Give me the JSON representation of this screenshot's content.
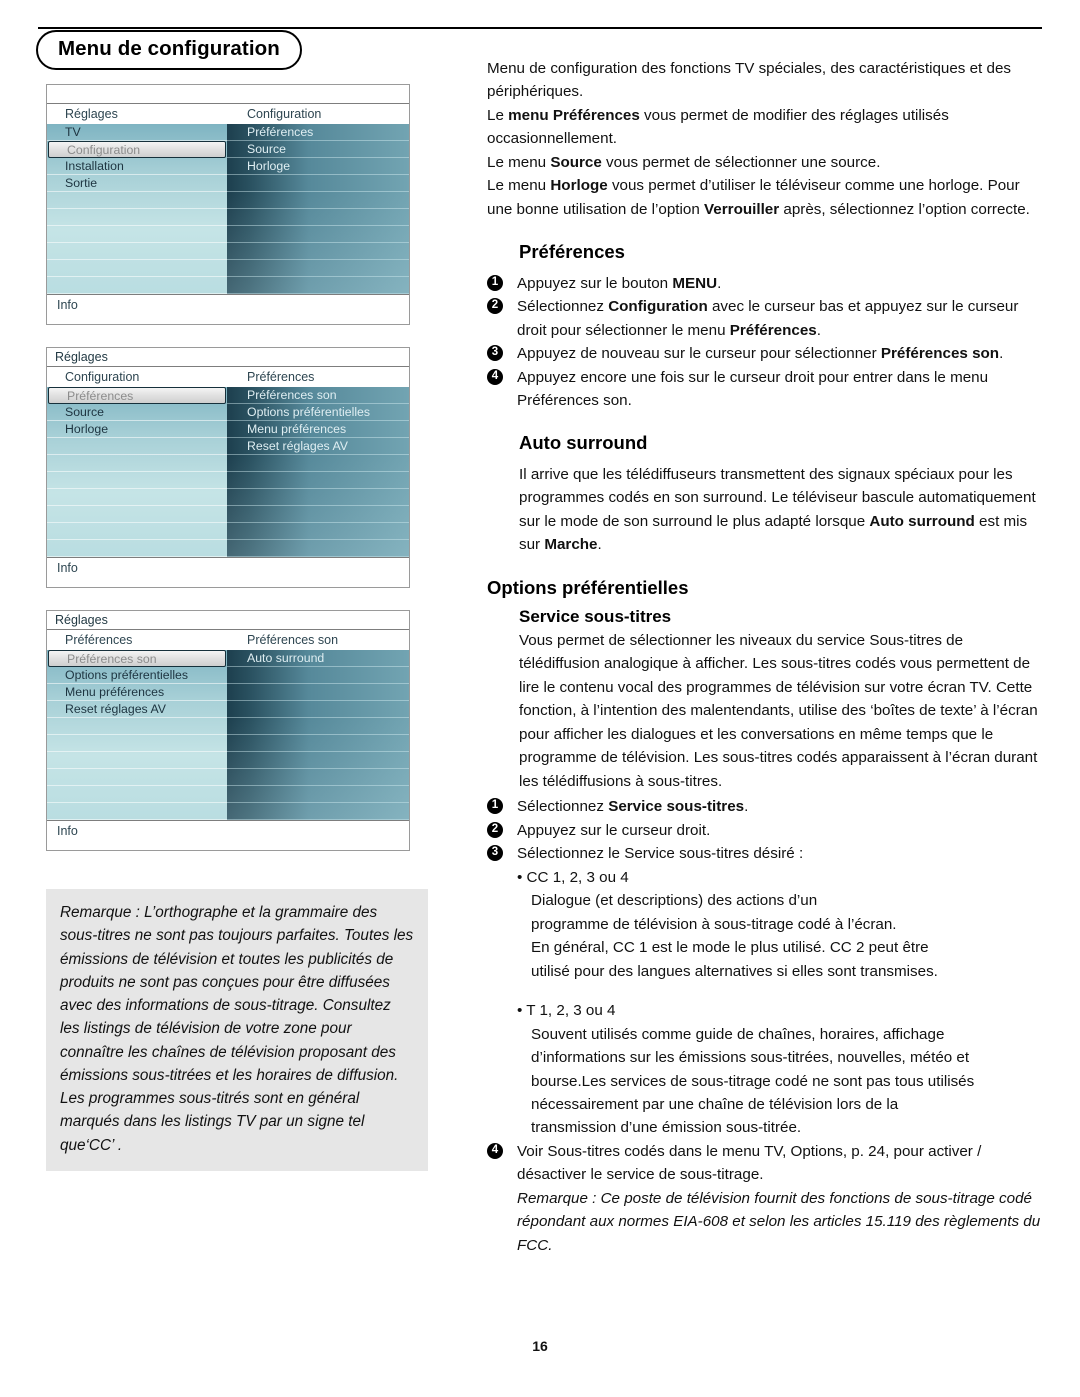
{
  "document": {
    "title": "Menu de configuration",
    "page_number": "16"
  },
  "menus": [
    {
      "name": "menu-configuration",
      "titlebar": "",
      "col_head_left": "Réglages",
      "col_head_right": "Configuration",
      "left_items": [
        {
          "label": "TV",
          "selected": false
        },
        {
          "label": "Configuration",
          "selected": true
        },
        {
          "label": "Installation",
          "selected": false
        },
        {
          "label": "Sortie",
          "selected": false
        }
      ],
      "right_items": [
        "Préférences",
        "Source",
        "Horloge"
      ],
      "info_label": "Info"
    },
    {
      "name": "menu-preferences",
      "titlebar": "Réglages",
      "col_head_left": "Configuration",
      "col_head_right": "Préférences",
      "left_items": [
        {
          "label": "Préférences",
          "selected": true
        },
        {
          "label": "Source",
          "selected": false
        },
        {
          "label": "Horloge",
          "selected": false
        }
      ],
      "right_items": [
        "Préférences son",
        "Options préférentielles",
        "Menu préférences",
        "Reset réglages AV"
      ],
      "info_label": "Info"
    },
    {
      "name": "menu-preferences-son",
      "titlebar": "Réglages",
      "col_head_left": "Préférences",
      "col_head_right": "Préférences son",
      "left_items": [
        {
          "label": "Préférences son",
          "selected": true
        },
        {
          "label": "Options préférentielles",
          "selected": false
        },
        {
          "label": "Menu préférences",
          "selected": false
        },
        {
          "label": "Reset réglages AV",
          "selected": false
        }
      ],
      "right_items": [
        "Auto surround"
      ],
      "info_label": "Info"
    }
  ],
  "remark_box": {
    "text": "Remarque : L’orthographe et la grammaire des sous-titres ne sont pas toujours parfaites. Toutes les émissions de télévision et toutes les publicités de produits ne sont pas conçues pour être diffusées avec des informations de sous-titrage. Consultez les listings de télévision de votre zone pour connaître les chaînes de télévision proposant des émissions sous-titrées et les horaires de diffusion. Les programmes sous-titrés sont en général marqués dans les listings TV par un signe tel que‘CC’ ."
  },
  "intro": {
    "line1": "Menu de configuration des fonctions TV spéciales, des caractéristiques et des périphériques.",
    "line2_pre": "Le ",
    "line2_bold": "menu Préférences",
    "line2_post": " vous permet de modifier des réglages utilisés occasionnellement.",
    "line3_pre": "Le menu ",
    "line3_bold": "Source",
    "line3_post": " vous permet de sélectionner une source.",
    "line4_pre": "Le menu ",
    "line4_bold": "Horloge",
    "line4_mid": " vous permet d’utiliser le téléviseur comme une horloge. Pour une bonne utilisation de l’option ",
    "line4_bold2": "Verrouiller",
    "line4_post": " après, sélectionnez l’option correcte."
  },
  "preferences": {
    "heading": "Préférences",
    "steps": [
      {
        "num": "1",
        "pre": "Appuyez sur le bouton ",
        "bold": "MENU",
        "post": "."
      },
      {
        "num": "2",
        "pre": "Sélectionnez ",
        "bold": "Configuration",
        "mid": " avec le curseur bas et appuyez sur le curseur droit pour sélectionner le menu ",
        "bold2": "Préférences",
        "post": "."
      },
      {
        "num": "3",
        "pre": "Appuyez de nouveau sur le curseur pour sélectionner ",
        "bold": "Préférences son",
        "post": "."
      },
      {
        "num": "4",
        "pre": "Appuyez encore une fois sur le curseur droit pour entrer dans le menu Préférences son.",
        "bold": "",
        "post": ""
      }
    ]
  },
  "auto_surround": {
    "heading": "Auto surround",
    "body_pre": "Il arrive que les télédiffuseurs transmettent des signaux spéciaux pour les programmes codés en son surround. Le téléviseur bascule automatiquement sur le mode de son surround le plus adapté lorsque ",
    "body_bold": "Auto surround",
    "body_mid": " est mis sur ",
    "body_bold2": "Marche",
    "body_post": "."
  },
  "options_preferentielles": {
    "heading": "Options préférentielles",
    "subheading": "Service sous-titres",
    "body": "Vous permet de sélectionner les niveaux du service Sous-titres de télédiffusion analogique à afficher. Les sous-titres codés vous permettent de lire le contenu vocal des programmes de télévision sur votre écran TV. Cette fonction, à l’intention des malentendants, utilise des ‘boîtes de texte’ à l’écran pour afficher les dialogues et les conversations en même temps que le programme de télévision. Les sous-titres codés apparaissent à l’écran durant les télédiffusions à sous-titres.",
    "steps": [
      {
        "num": "1",
        "pre": "Sélectionnez ",
        "bold": "Service sous-titres",
        "post": "."
      },
      {
        "num": "2",
        "pre": "Appuyez sur le curseur droit.",
        "bold": "",
        "post": ""
      },
      {
        "num": "3",
        "pre": "Sélectionnez le Service sous-titres désiré :",
        "bold": "",
        "post": ""
      }
    ],
    "bullet_cc": {
      "label": "• CC 1, 2, 3 ou 4",
      "lines": [
        "Dialogue (et descriptions) des actions d’un",
        "programme de télévision à sous-titrage codé à l’écran.",
        "En général, CC 1 est le mode le plus utilisé. CC 2 peut être",
        "utilisé pour des langues alternatives si elles sont transmises."
      ]
    },
    "bullet_t": {
      "label": "• T 1, 2, 3 ou 4",
      "lines": [
        "Souvent utilisés comme guide de chaînes, horaires, affichage",
        "d’informations sur les émissions sous-titrées, nouvelles, météo et",
        "bourse.Les services de sous-titrage codé ne sont pas tous utilisés",
        "nécessairement par une chaîne de télévision lors de la",
        "transmission d’une émission sous-titrée."
      ]
    },
    "step4": {
      "num": "4",
      "text": "Voir Sous-titres codés dans le menu TV, Options, p. 24, pour activer / désactiver le service de sous-titrage."
    },
    "final_note": "Remarque : Ce poste de télévision fournit des fonctions de sous-titrage codé répondant aux normes EIA-608 et selon les articles 15.119 des règlements du FCC."
  }
}
